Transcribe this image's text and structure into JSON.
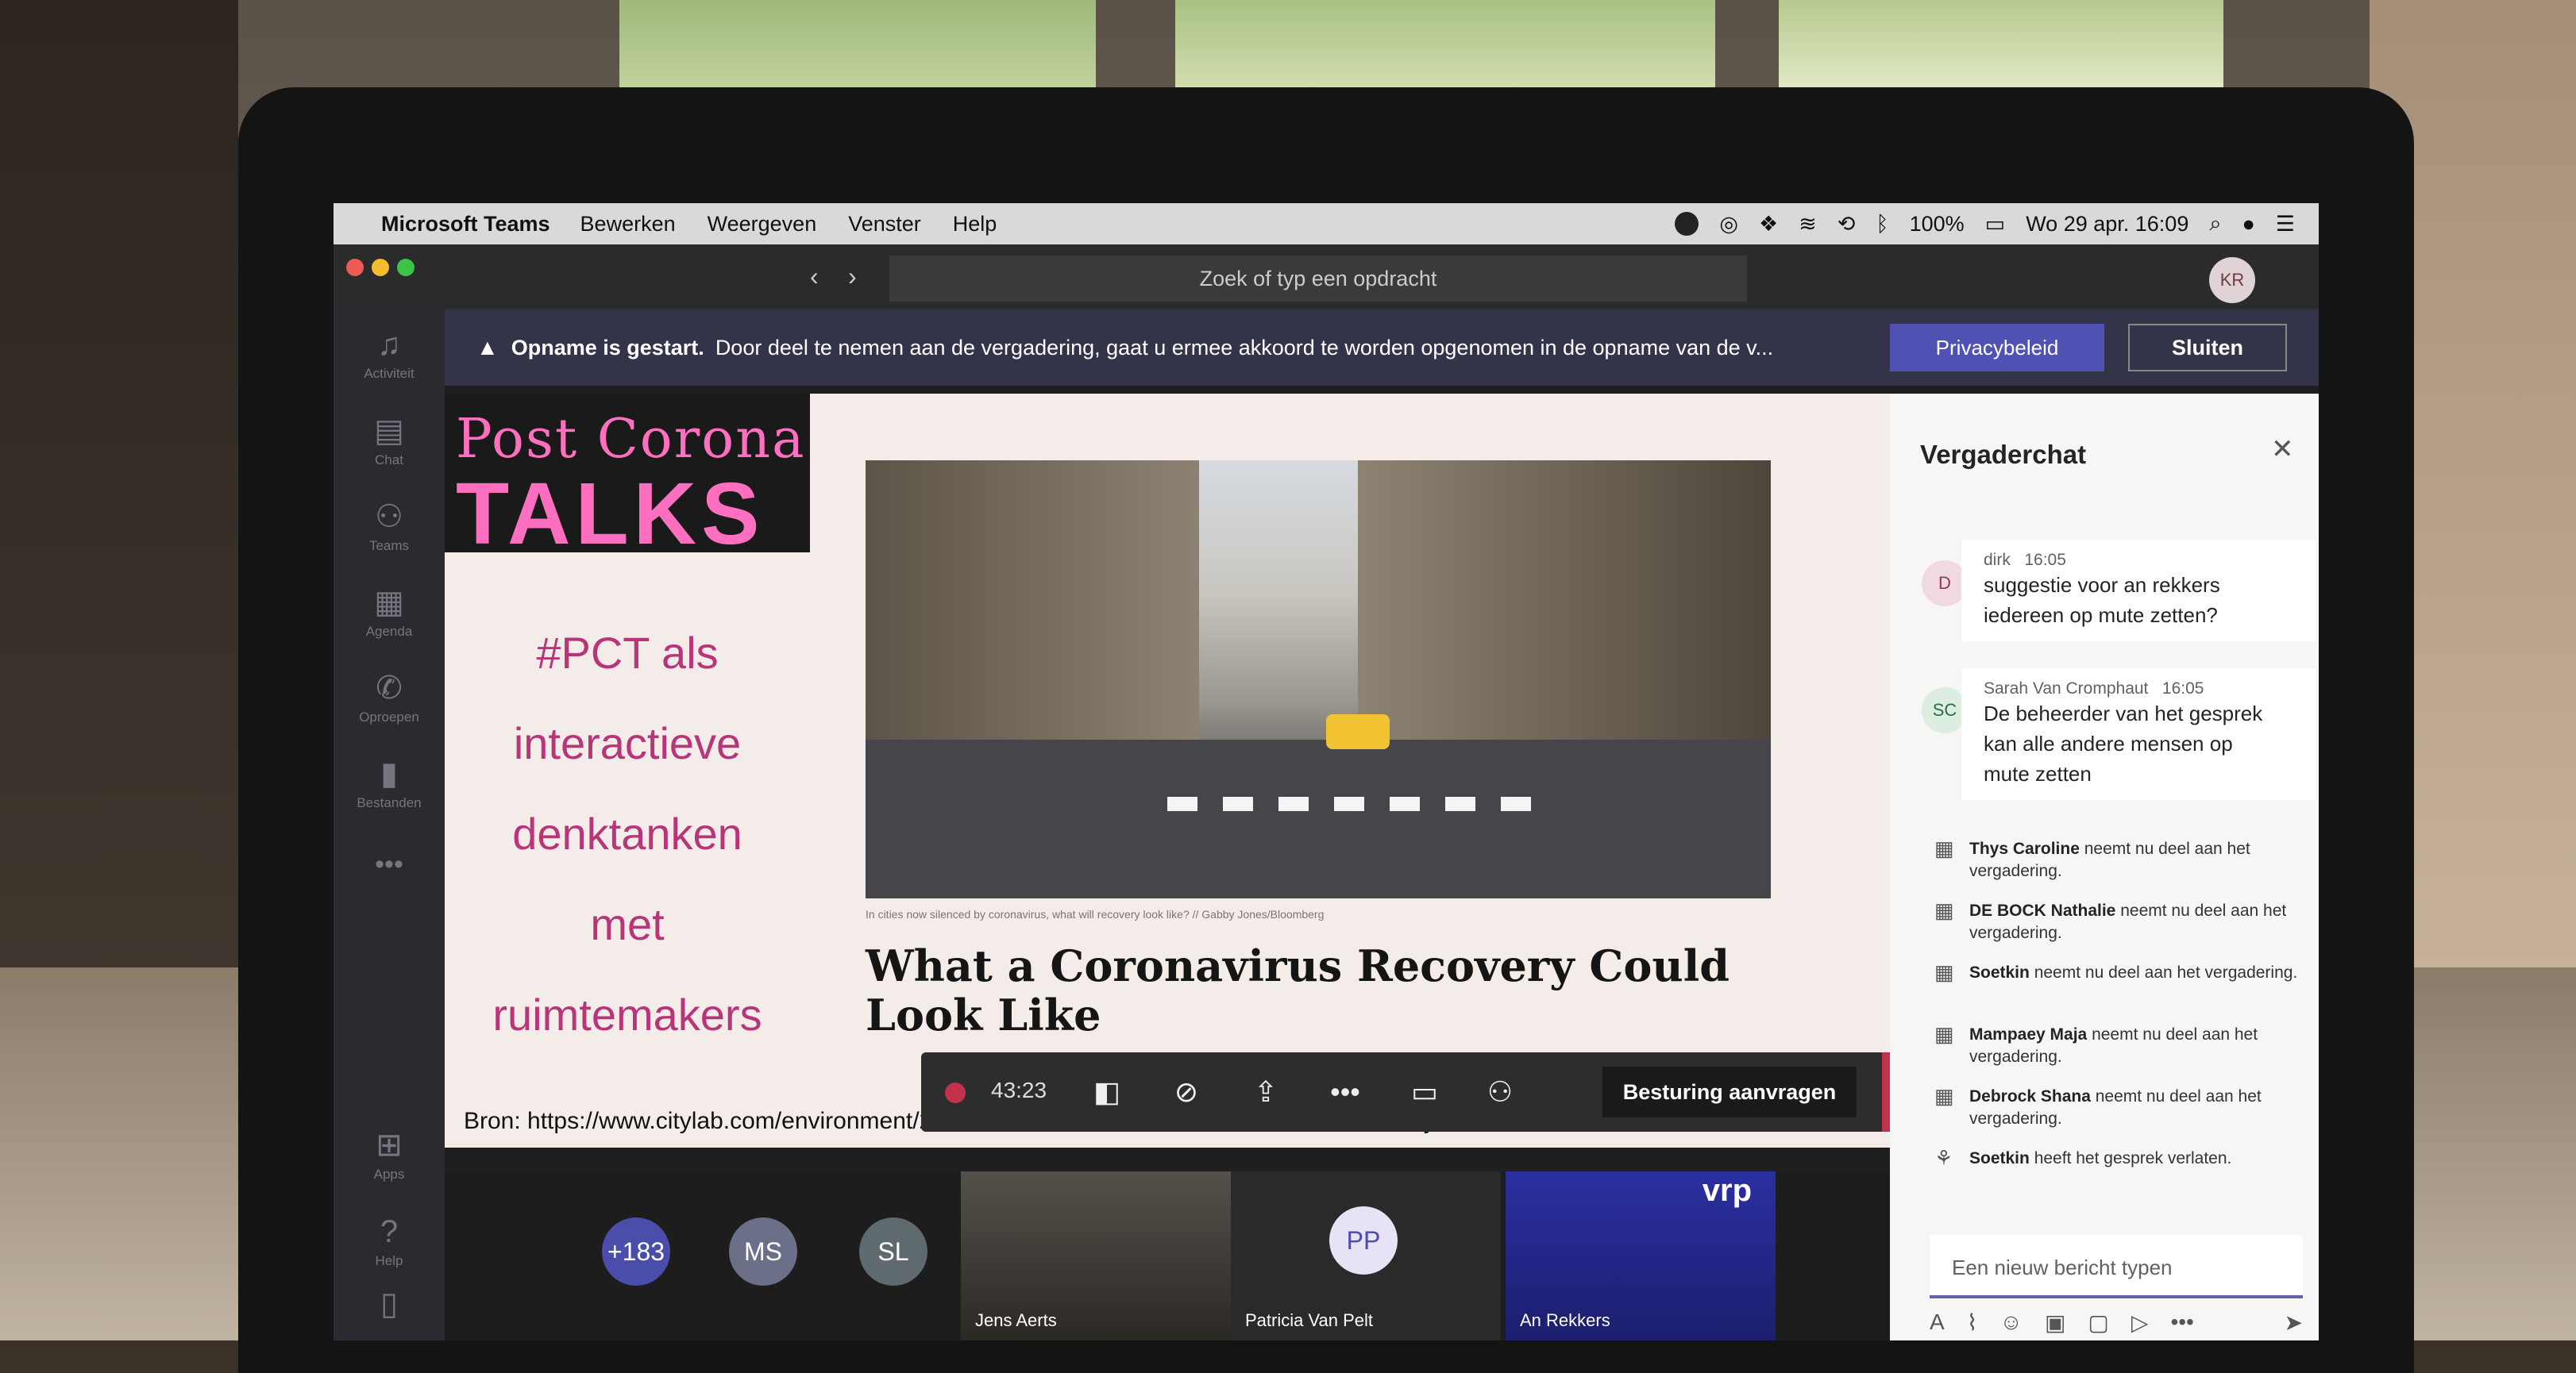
{
  "menubar": {
    "app": "Microsoft Teams",
    "items": [
      "Bewerken",
      "Weergeven",
      "Venster",
      "Help"
    ],
    "battery": "100%",
    "datetime": "Wo 29 apr. 16:09"
  },
  "titlebar": {
    "search_placeholder": "Zoek of typ een opdracht",
    "user_initials": "KR"
  },
  "rail": {
    "items": [
      "Activiteit",
      "Chat",
      "Teams",
      "Agenda",
      "Oproepen",
      "Bestanden",
      "Apps",
      "Help"
    ]
  },
  "banner": {
    "bold": "Opname is gestart.",
    "message": "Door deel te nemen aan de vergadering, gaat u ermee akkoord te worden opgenomen in de opname van de v...",
    "privacy_label": "Privacybeleid",
    "close_label": "Sluiten"
  },
  "slide": {
    "logo_line1": "Post Corona",
    "logo_line2": "TALKS",
    "text_lines": [
      "#PCT als",
      "interactieve",
      "denktanken",
      "met",
      "ruimtemakers"
    ],
    "caption": "In cities now silenced by coronavirus, what will recovery look like? // Gabby Jones/Bloomberg",
    "headline": "What a Coronavirus Recovery Could Look Like",
    "bron": "Bron: https://www.citylab.com/environment/2020/03/coronavirus-urban-resilience-community-economies-covid-19/608422/"
  },
  "controls": {
    "timer": "43:23",
    "request_control": "Besturing aanvragen"
  },
  "participants": {
    "overflow": "+183",
    "circles": [
      "MS",
      "SL"
    ],
    "video_tiles": [
      "Jens Aerts",
      "An Rekkers"
    ],
    "avatar_tile": {
      "initials": "PP",
      "name": "Patricia Van Pelt"
    },
    "tile_badge": "vrp"
  },
  "chat": {
    "title": "Vergaderchat",
    "messages": [
      {
        "initials": "D",
        "author": "dirk",
        "time": "16:05",
        "lines": [
          "suggestie voor an rekkers",
          "iedereen op mute zetten?"
        ]
      },
      {
        "initials": "SC",
        "author": "Sarah Van Cromphaut",
        "time": "16:05",
        "lines": [
          "De beheerder van het gesprek",
          "kan alle andere mensen op",
          "mute zetten"
        ]
      }
    ],
    "events": [
      {
        "name": "Thys Caroline",
        "text": "neemt nu deel aan het vergadering."
      },
      {
        "name": "DE BOCK Nathalie",
        "text": "neemt nu deel aan het vergadering."
      },
      {
        "name": "Soetkin",
        "text": "neemt nu deel aan het vergadering."
      },
      {
        "name": "Mampaey Maja",
        "text": "neemt nu deel aan het vergadering."
      },
      {
        "name": "Debrock Shana",
        "text": "neemt nu deel aan het vergadering."
      },
      {
        "name": "Soetkin",
        "text": "heeft het gesprek verlaten."
      }
    ],
    "compose_placeholder": "Een nieuw bericht typen"
  },
  "colors": {
    "accent": "#6264a7",
    "banner": "#33344a",
    "hangup": "#c4314b",
    "brand_pink": "#ff6fbf"
  }
}
